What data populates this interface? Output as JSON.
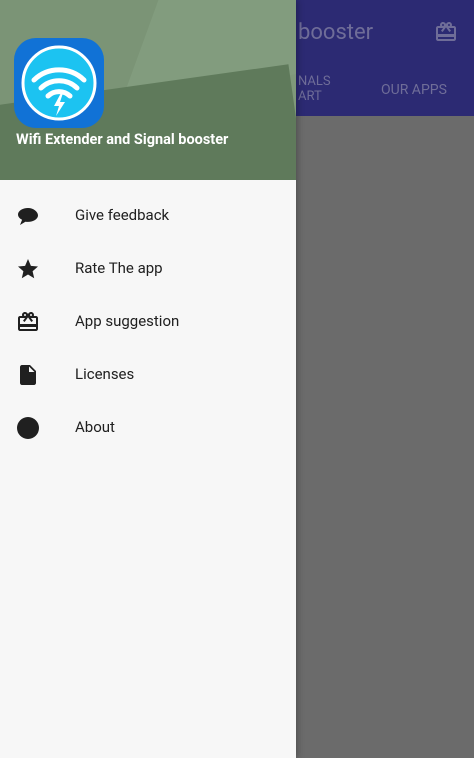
{
  "app": {
    "title_partial": "booster",
    "tabs": [
      "NALS ART",
      "OUR APPS"
    ]
  },
  "drawer": {
    "app_name": "Wifi Extender and Signal booster",
    "items": [
      {
        "label": "Give feedback",
        "icon": "chat-bubble-icon"
      },
      {
        "label": "Rate The app",
        "icon": "star-icon"
      },
      {
        "label": "App suggestion",
        "icon": "gift-icon"
      },
      {
        "label": "Licenses",
        "icon": "file-icon"
      },
      {
        "label": "About",
        "icon": "circle-icon"
      }
    ]
  },
  "colors": {
    "app_bar": "#2c2a73",
    "drawer_header": "#6f8a6a",
    "app_icon": "#1172d6",
    "dim_overlay": "#6b6b6b"
  }
}
